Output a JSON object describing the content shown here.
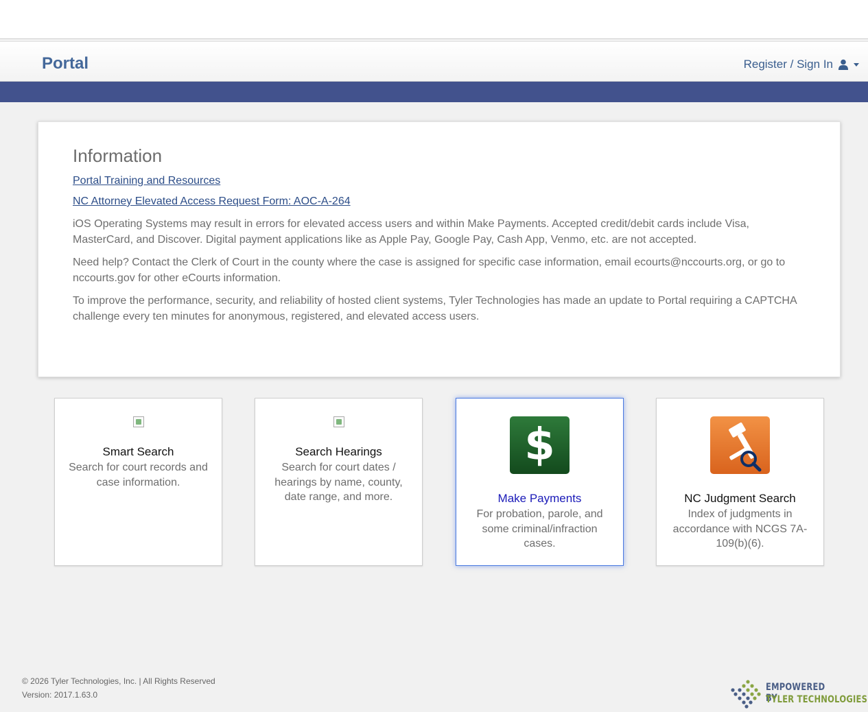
{
  "header": {
    "brand": "Portal",
    "signin_label": "Register / Sign In"
  },
  "info": {
    "title": "Information",
    "links": [
      "Portal Training and Resources",
      "NC Attorney Elevated Access Request Form: AOC-A-264"
    ],
    "paragraphs": [
      "iOS Operating Systems may result in errors for elevated access users and within Make Payments. Accepted credit/debit cards include Visa, MasterCard, and Discover. Digital payment applications like as Apple Pay, Google Pay, Cash App, Venmo, etc. are not accepted.",
      "Need help? Contact the Clerk of Court in the county where the case is assigned for specific case information, email ecourts@nccourts.org, or go to nccourts.gov for other eCourts information.",
      "To improve the performance, security, and reliability of hosted client systems, Tyler Technologies has made an update to Portal requiring a CAPTCHA challenge every ten minutes for anonymous, registered, and elevated access users."
    ]
  },
  "tiles": [
    {
      "title": "Smart Search",
      "desc": "Search for court records and case information."
    },
    {
      "title": "Search Hearings",
      "desc": "Search for court dates / hearings by name, county, date range, and more."
    },
    {
      "title": "Make Payments",
      "desc": "For probation, parole, and some criminal/infraction cases."
    },
    {
      "title": "NC Judgment Search",
      "desc": "Index of judgments in accordance with NCGS 7A-109(b)(6)."
    }
  ],
  "footer": {
    "copyright": "© 2026 Tyler Technologies, Inc. | All Rights Reserved",
    "version": "Version: 2017.1.63.0",
    "logo_line1": "EMPOWERED BY",
    "logo_line2": "TYLER TECHNOLOGIES"
  },
  "colors": {
    "brand": "#44689a",
    "band": "#42528d",
    "link": "#2c4d88",
    "payments_icon": "#1f5c28",
    "judgment_icon": "#e8772f"
  }
}
